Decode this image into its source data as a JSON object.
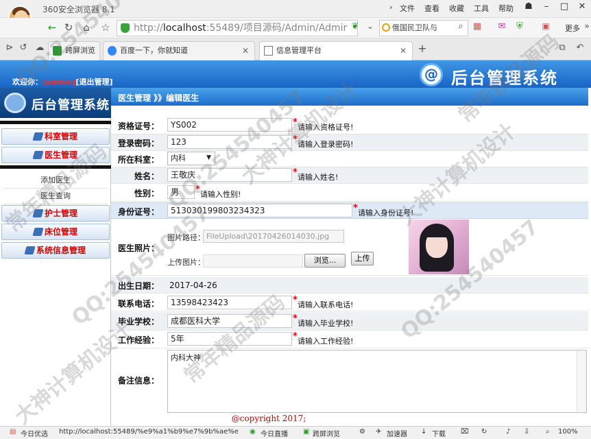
{
  "browser": {
    "name": "360安全浏览器 8.1",
    "menu": [
      "文件",
      "查看",
      "收藏",
      "工具",
      "帮助"
    ],
    "more_label": "更多",
    "address": {
      "prefix": "http://",
      "host": "localhost",
      "rest": ":55489/项目源码/Admin/Admir"
    },
    "search_text": "俄国民卫队与",
    "tabs": [
      {
        "label": "跨屏浏览",
        "active": false
      },
      {
        "label": "百度一下，你就知道",
        "active": false
      },
      {
        "label": "信息管理平台",
        "active": true
      }
    ],
    "statusbar": {
      "today_pick": "今日优选",
      "url": "http://localhost:55489/%e9%a1%b9%e7%9b%ae%e",
      "live": "今日直播",
      "cross": "跨屏浏览",
      "accelerator": "加速器",
      "download": "下载",
      "zoom": "100%"
    }
  },
  "header": {
    "welcome_prefix": "欢迎你：",
    "user": "[admin]",
    "logout": "[退出管理]",
    "logo_symbol": "@",
    "system_title": "后台管理系统"
  },
  "sidebar": {
    "logo_text": "后台管理系统",
    "menus": [
      "科室管理",
      "医生管理",
      "护士管理",
      "床位管理",
      "系统信息管理"
    ],
    "subitems": [
      "添加医生",
      "医生查询"
    ]
  },
  "breadcrumb": "医生管理 》》编辑医生",
  "form": {
    "license_label": "资格证号：",
    "license_value": "YS002",
    "license_hint": "请输入资格证号!",
    "password_label": "登录密码：",
    "password_value": "123",
    "password_hint": "请输入登录密码!",
    "dept_label": "所在科室：",
    "dept_value": "内科",
    "name_label": "姓名：",
    "name_value": "王敬庆",
    "name_hint": "请输入姓名!",
    "gender_label": "性别：",
    "gender_value": "男",
    "gender_hint": "请输入性别!",
    "idcard_label": "身份证号：",
    "idcard_value": "513030199803234323",
    "idcard_hint": "请输入身份证号!",
    "photo_label": "医生照片：",
    "photo_path_label": "图片路径：",
    "photo_path_value": "FileUpload\\20170426014030.jpg",
    "upload_label": "上传图片：",
    "browse_button": "浏览...",
    "upload_button": "上传",
    "birth_label": "出生日期：",
    "birth_value": "2017-04-26",
    "phone_label": "联系电话：",
    "phone_value": "13598423423",
    "phone_hint": "请输入联系电话!",
    "school_label": "毕业学校：",
    "school_value": "成都医科大学",
    "school_hint": "请输入毕业学校!",
    "exp_label": "工作经验：",
    "exp_value": "5年",
    "exp_hint": "请输入工作经验!",
    "remark_label": "备注信息：",
    "remark_value": "内科大神",
    "required_mark": "*"
  },
  "copyright": "@copyright 2017;",
  "watermarks": [
    "QQ:254540457",
    "大神计算机设计",
    "常年精品源码",
    "QQ:254540457",
    "大神计算机设计",
    "常年精品源码",
    "QQ:254540457",
    "大神计算机设计",
    "QQ:254540457",
    "常年精品源码"
  ]
}
